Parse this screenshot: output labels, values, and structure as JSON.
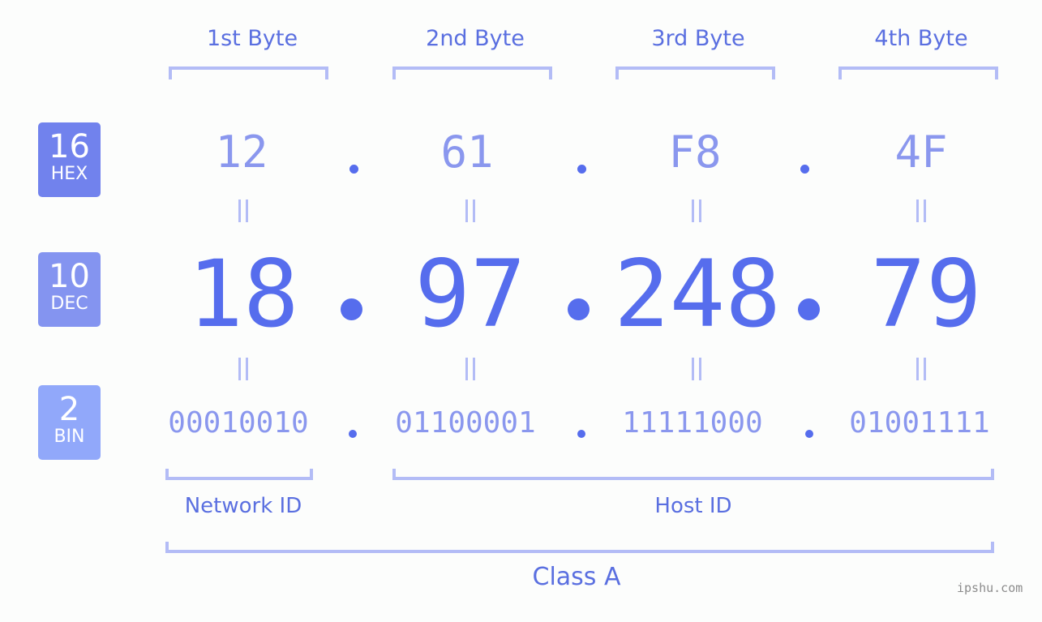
{
  "bytes": [
    {
      "label": "1st Byte",
      "hex": "12",
      "dec": "18",
      "bin": "00010010"
    },
    {
      "label": "2nd Byte",
      "hex": "61",
      "dec": "97",
      "bin": "01100001"
    },
    {
      "label": "3rd Byte",
      "hex": "F8",
      "dec": "248",
      "bin": "11111000"
    },
    {
      "label": "4th Byte",
      "hex": "4F",
      "dec": "79",
      "bin": "01001111"
    }
  ],
  "badges": {
    "hex": {
      "base": "16",
      "name": "HEX",
      "color": "#7182ed"
    },
    "dec": {
      "base": "10",
      "name": "DEC",
      "color": "#8494f0"
    },
    "bin": {
      "base": "2",
      "name": "BIN",
      "color": "#91a8fa"
    }
  },
  "separator": ".",
  "network_id_label": "Network ID",
  "host_id_label": "Host ID",
  "class_label": "Class A",
  "watermark": "ipshu.com",
  "colors": {
    "accent": "#566ded",
    "light": "#8a97ee",
    "bracket": "#b3bcf6",
    "background": "#fcfdfc"
  }
}
